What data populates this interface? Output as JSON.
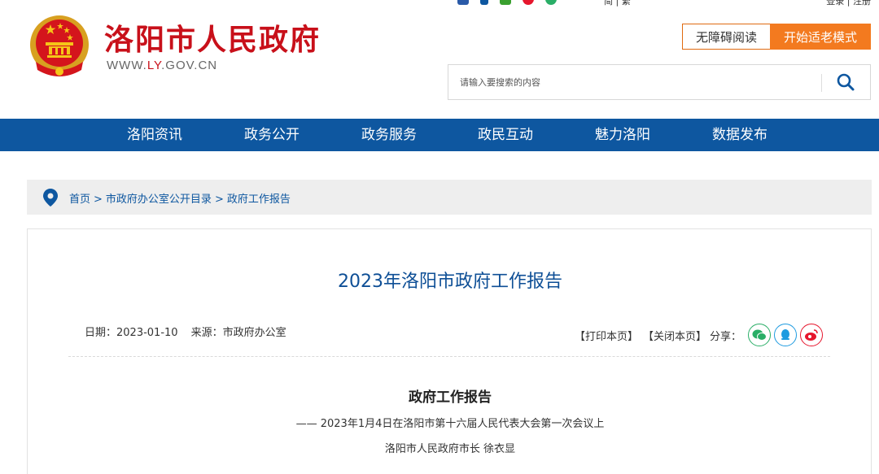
{
  "topbar": {
    "lang": "简 | 繁",
    "login": "登录 | 注册",
    "icons": [
      "police-icon",
      "mobile-icon",
      "wechat-icon",
      "weibo-icon",
      "wechat-chat-icon"
    ]
  },
  "header": {
    "title": "洛阳市人民政府",
    "url_prefix": "WWW.",
    "url_highlight": "LY",
    "url_suffix": ".GOV.CN",
    "accessible_reading": "无障碍阅读",
    "elderly_mode": "开始适老模式"
  },
  "search": {
    "placeholder": "请输入要搜索的内容"
  },
  "nav": {
    "items": [
      "洛阳资讯",
      "政务公开",
      "政务服务",
      "政民互动",
      "魅力洛阳",
      "数据发布"
    ]
  },
  "breadcrumb": {
    "home": "首页",
    "sep": ">",
    "level1": "市政府办公室公开目录",
    "level2": "政府工作报告"
  },
  "article": {
    "title": "2023年洛阳市政府工作报告",
    "date_label": "日期：2023-01-10",
    "source_label": "来源：市政府办公室",
    "print": "【打印本页】",
    "close": "【关闭本页】",
    "share": "分享：",
    "subtitle": "政府工作报告",
    "occasion": "—— 2023年1月4日在洛阳市第十六届人民代表大会第一次会议上",
    "author": "洛阳市人民政府市长  徐衣显"
  },
  "colors": {
    "brand_red": "#c8101a",
    "nav_blue": "#0e57a0",
    "accent_orange": "#f37a1f",
    "wechat_green": "#2aae67",
    "qq_blue": "#1e9be0",
    "weibo_red": "#e6162d"
  }
}
